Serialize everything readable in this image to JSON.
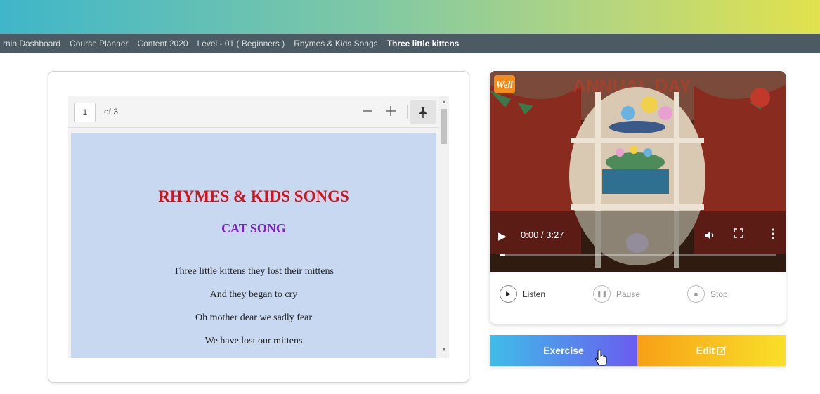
{
  "breadcrumb": {
    "items": [
      "rnin Dashboard",
      "Course Planner",
      "Content 2020",
      "Level - 01 ( Beginners )",
      "Rhymes & Kids Songs"
    ],
    "current": "Three little kittens"
  },
  "pdf_viewer": {
    "page_number": "1",
    "page_count_label": "of 3",
    "zoom_out_icon": "minus-icon",
    "zoom_in_icon": "plus-icon",
    "pin_icon": "pin-icon",
    "document": {
      "title": "RHYMES & KIDS SONGS",
      "subtitle": "CAT SONG",
      "lines": [
        "Three little kittens they lost their mittens",
        "And they began to cry",
        "Oh mother dear we sadly fear",
        "We have lost our mittens"
      ]
    }
  },
  "video": {
    "logo_text": "Well",
    "time": "0:00 / 3:27",
    "progress": 0.02
  },
  "audio_controls": {
    "listen": "Listen",
    "pause": "Pause",
    "stop": "Stop"
  },
  "actions": {
    "exercise": "Exercise",
    "edit": "Edit"
  },
  "colors": {
    "title_red": "#d1131c",
    "subtitle_purple": "#7a24c2",
    "pdf_page_bg": "#c8d8f0",
    "breadcrumb_bg": "#4c5a63"
  }
}
